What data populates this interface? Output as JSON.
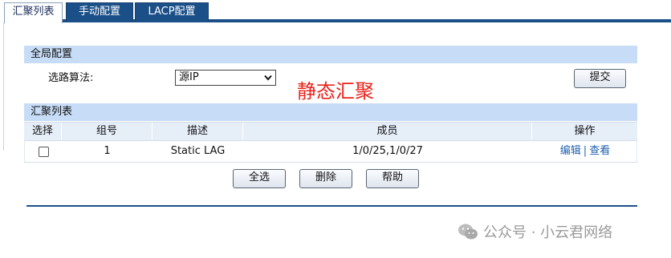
{
  "tabs": [
    {
      "label": "汇聚列表",
      "active": true
    },
    {
      "label": "手动配置",
      "active": false
    },
    {
      "label": "LACP配置",
      "active": false
    }
  ],
  "global": {
    "header": "全局配置",
    "algo_label": "选路算法:",
    "algo_value": "源IP",
    "submit_label": "提交"
  },
  "overlay_text": "静态汇聚",
  "list": {
    "header": "汇聚列表",
    "columns": [
      "选择",
      "组号",
      "描述",
      "成员",
      "操作"
    ],
    "rows": [
      {
        "checked": false,
        "group": "1",
        "desc": "Static LAG",
        "members": "1/0/25,1/0/27",
        "edit": "编辑",
        "sep": "|",
        "view": "查看"
      }
    ]
  },
  "actions": {
    "select_all": "全选",
    "delete": "删除",
    "help": "帮助"
  },
  "watermark": "公众号 · 小云君网络",
  "colors": {
    "tab_blue": "#1b4f88",
    "header_bg": "#c7dcf6",
    "link": "#1f5fb0",
    "overlay_red": "#e8231b"
  },
  "icons": [
    "chevron-down-icon",
    "wechat-logo-icon"
  ]
}
